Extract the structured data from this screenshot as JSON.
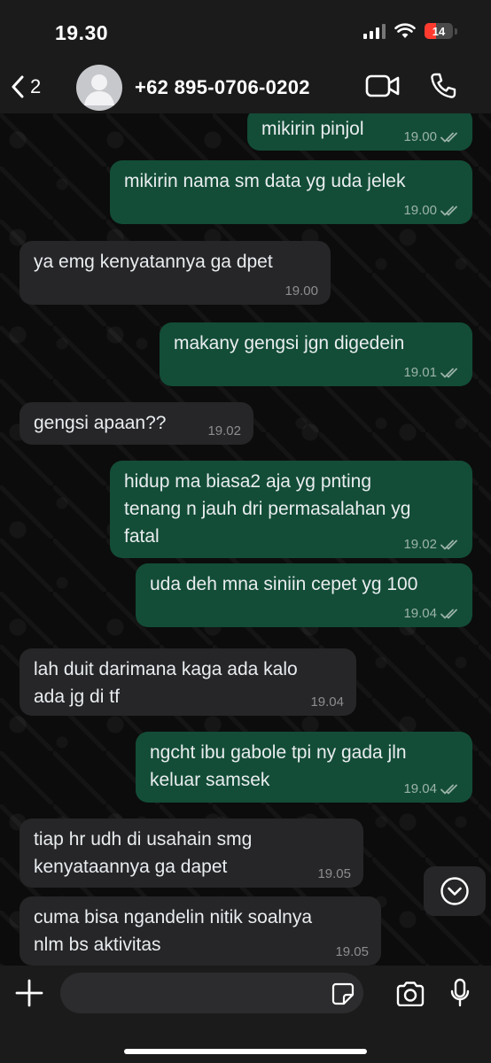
{
  "status_bar": {
    "time": "19.30",
    "battery": "14"
  },
  "header": {
    "back_count": "2",
    "contact": "+62 895-0706-0202"
  },
  "messages": [
    {
      "dir": "out",
      "text": "mikirin pinjol",
      "time": "19.00"
    },
    {
      "dir": "out",
      "text": "mikirin nama sm data yg uda jelek",
      "time": "19.00"
    },
    {
      "dir": "in",
      "text": "ya emg kenyatannya ga dpet",
      "time": "19.00"
    },
    {
      "dir": "out",
      "text": "makany gengsi jgn digedein",
      "time": "19.01"
    },
    {
      "dir": "in",
      "text": "gengsi apaan??",
      "time": "19.02"
    },
    {
      "dir": "out",
      "text": "hidup ma biasa2 aja yg pnting\ntenang n jauh dri permasalahan yg\nfatal",
      "time": "19.02"
    },
    {
      "dir": "out",
      "text": "uda deh mna siniin cepet yg 100",
      "time": "19.04"
    },
    {
      "dir": "in",
      "text": "lah duit darimana kaga ada kalo\nada jg di tf",
      "time": "19.04"
    },
    {
      "dir": "out",
      "text": "ngcht ibu gabole tpi ny gada jln\nkeluar samsek",
      "time": "19.04"
    },
    {
      "dir": "in",
      "text": "tiap hr udh di usahain smg\nkenyataannya ga dapet",
      "time": "19.05"
    },
    {
      "dir": "in",
      "text": "cuma bisa ngandelin nitik soalnya\nnlm bs aktivitas",
      "time": "19.05"
    }
  ],
  "input": {
    "placeholder": ""
  },
  "colors": {
    "outgoing_bubble": "#134d37",
    "incoming_bubble": "#262628",
    "read_ticks": "#9bb3a8",
    "battery_low": "#ff3b30"
  }
}
